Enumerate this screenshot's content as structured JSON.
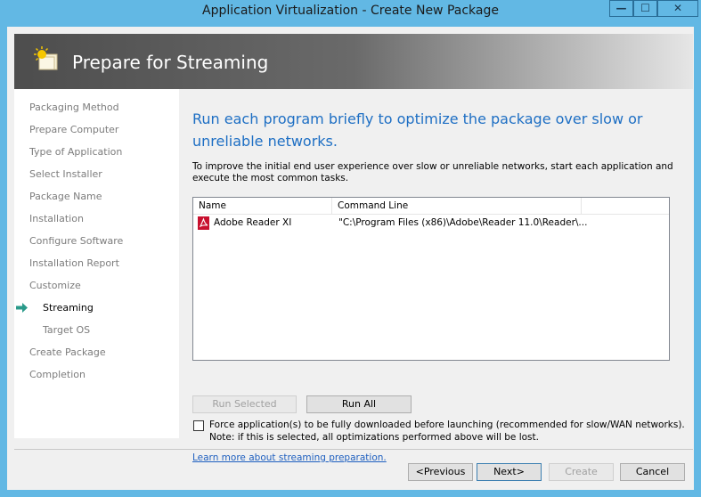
{
  "window": {
    "title": "Application Virtualization - Create New Package",
    "controls": {
      "minimize": "—",
      "maximize": "☐",
      "close": "✕"
    }
  },
  "banner": {
    "title": "Prepare for Streaming",
    "icon": "wizard-sun-icon"
  },
  "nav": {
    "items": [
      {
        "label": "Packaging Method",
        "state": "done"
      },
      {
        "label": "Prepare Computer",
        "state": "done"
      },
      {
        "label": "Type of Application",
        "state": "done"
      },
      {
        "label": "Select Installer",
        "state": "done"
      },
      {
        "label": "Package Name",
        "state": "done"
      },
      {
        "label": "Installation",
        "state": "done"
      },
      {
        "label": "Configure Software",
        "state": "done"
      },
      {
        "label": "Installation Report",
        "state": "done"
      },
      {
        "label": "Customize",
        "state": "done"
      },
      {
        "label": "Streaming",
        "state": "active",
        "sub": true
      },
      {
        "label": "Target OS",
        "state": "pending",
        "sub": true
      },
      {
        "label": "Create Package",
        "state": "pending"
      },
      {
        "label": "Completion",
        "state": "pending"
      }
    ],
    "active_icon": "green-arrow-icon"
  },
  "main": {
    "heading": "Run each program briefly to optimize the package over slow or unreliable networks.",
    "description": "To improve the initial end user experience over slow or unreliable networks, start each application and execute the most common tasks.",
    "table": {
      "columns": [
        "Name",
        "Command Line"
      ],
      "rows": [
        {
          "name": "Adobe Reader XI",
          "command": "\"C:\\Program Files (x86)\\Adobe\\Reader 11.0\\Reader\\...",
          "icon": "pdf-icon"
        }
      ]
    },
    "buttons": {
      "run_selected": "Run Selected",
      "run_all": "Run All"
    },
    "force_download": {
      "checked": false,
      "label": "Force application(s) to be fully downloaded before launching (recommended for slow/WAN networks).",
      "note": "Note: if this is selected, all optimizations performed above will be lost."
    },
    "learn_more": "Learn more about streaming preparation."
  },
  "footer": {
    "previous": "<Previous",
    "next": "Next>",
    "create": "Create",
    "cancel": "Cancel"
  },
  "colors": {
    "accent": "#1e6fc4",
    "frame": "#62b8e4",
    "active_arrow": "#2a9a8a"
  }
}
